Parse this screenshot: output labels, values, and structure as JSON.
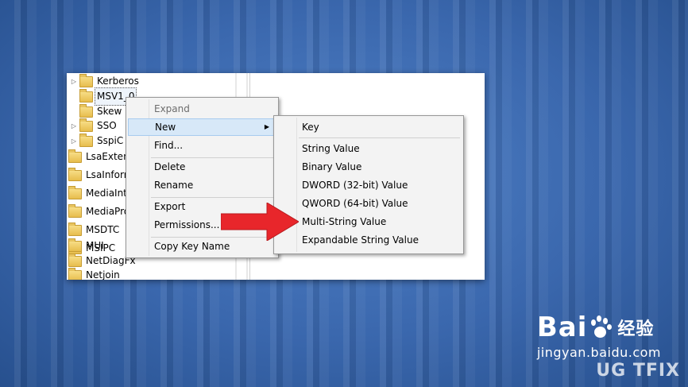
{
  "tree": {
    "items": [
      {
        "label": "Kerberos",
        "expander": "▷"
      },
      {
        "label": "MSV1_0",
        "expander": ""
      },
      {
        "label": "Skew",
        "expander": ""
      },
      {
        "label": "SSO",
        "expander": "▷"
      },
      {
        "label": "SspiC",
        "expander": "▷"
      },
      {
        "label": "LsaExten",
        "expander": ""
      },
      {
        "label": "LsaInforn",
        "expander": ""
      },
      {
        "label": "MediaInt",
        "expander": ""
      },
      {
        "label": "MediaPro",
        "expander": ""
      },
      {
        "label": "MSDTC",
        "expander": ""
      },
      {
        "label": "MSIPC",
        "expander": ""
      },
      {
        "label": "MUI",
        "expander": ""
      },
      {
        "label": "NetDiagFx",
        "expander": ""
      },
      {
        "label": "Netjoin",
        "expander": ""
      }
    ]
  },
  "context_menu": {
    "expand": "Expand",
    "new": "New",
    "find": "Find...",
    "delete": "Delete",
    "rename": "Rename",
    "export": "Export",
    "permissions": "Permissions...",
    "copy_key_name": "Copy Key Name"
  },
  "new_submenu": {
    "key": "Key",
    "string_value": "String Value",
    "binary_value": "Binary Value",
    "dword_value": "DWORD (32-bit) Value",
    "qword_value": "QWORD (64-bit) Value",
    "multi_string_value": "Multi-String Value",
    "expandable_string_value": "Expandable String Value"
  },
  "branding": {
    "baidu_left": "Bai",
    "baidu_right": "经验",
    "url": "jingyan.baidu.com",
    "watermark": "UG  TFIX"
  },
  "colors": {
    "annotation_arrow": "#e8262b",
    "background_blue": "#3a67ad"
  },
  "icons": {
    "tree_folder": "folder-icon",
    "submenu": "chevron-right-icon",
    "annotation": "red-arrow-icon",
    "logo": "baidu-paw-icon"
  }
}
